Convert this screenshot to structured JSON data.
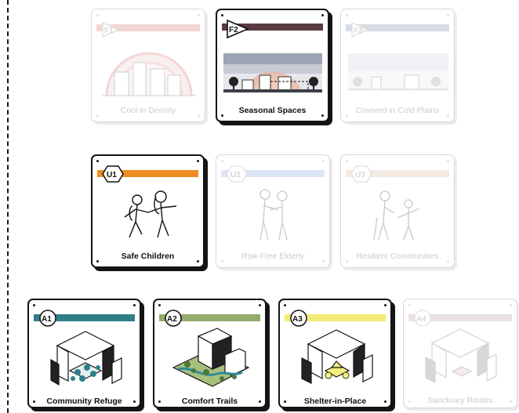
{
  "rows": [
    {
      "cards": [
        {
          "code": "F1",
          "title": "Cool in Density",
          "state": "inactive",
          "color": "#e8a3a3"
        },
        {
          "code": "F2",
          "title": "Seasonal Spaces",
          "state": "active",
          "color": "#5c3a42"
        },
        {
          "code": "F3",
          "title": "Covered in Cold Plains",
          "state": "inactive",
          "color": "#a8b6c4"
        }
      ]
    },
    {
      "cards": [
        {
          "code": "U1",
          "title": "Safe Children",
          "state": "active",
          "color": "#f08c23"
        },
        {
          "code": "U2",
          "title": "Risk-Free Elderly",
          "state": "inactive",
          "color": "#b3c4ea"
        },
        {
          "code": "U3",
          "title": "Resilient Communities",
          "state": "inactive",
          "color": "#e6d2bf"
        }
      ]
    },
    {
      "cards": [
        {
          "code": "A1",
          "title": "Community Refuge",
          "state": "active",
          "color": "#2f7f89"
        },
        {
          "code": "A2",
          "title": "Comfort Trails",
          "state": "active",
          "color": "#93ab6c"
        },
        {
          "code": "A3",
          "title": "Shelter-in-Place",
          "state": "active",
          "color": "#f2ec78"
        },
        {
          "code": "A4",
          "title": "Sanctuary Routes",
          "state": "inactive",
          "color": "#d4bcc6"
        }
      ]
    }
  ]
}
